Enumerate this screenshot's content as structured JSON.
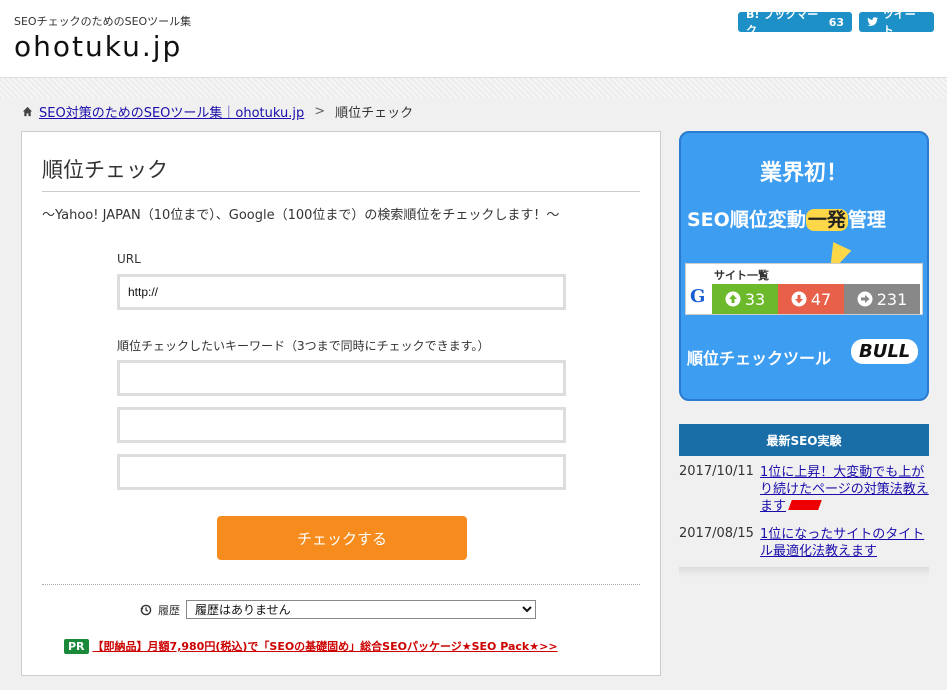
{
  "header": {
    "tagline": "SEOチェックのためのSEOツール集",
    "site_title": "ohotuku.jp",
    "hatena_label": "B! ブックマーク",
    "hatena_count": "63",
    "tweet_label": "ツイート"
  },
  "breadcrumb": {
    "home": "SEO対策のためのSEOツール集｜ohotuku.jp",
    "separator": ">",
    "current": "順位チェック"
  },
  "main": {
    "title": "順位チェック",
    "subtitle": "〜Yahoo! JAPAN（10位まで）、Google（100位まで）の検索順位をチェックします！〜",
    "url_label": "URL",
    "url_value": "http://",
    "keyword_label": "順位チェックしたいキーワード（3つまで同時にチェックできます。）",
    "keywords": [
      "",
      "",
      ""
    ],
    "submit_label": "チェックする",
    "history_label": "履歴",
    "history_selected": "履歴はありません",
    "pr_badge": "PR",
    "pr_text": "【即納品】月額7,980円(税込)で「SEOの基礎固め」総合SEOパッケージ★SEO Pack★>>"
  },
  "banner": {
    "headline": "業界初！",
    "main_text_before": "SEO順位変動",
    "main_text_highlight": "一発",
    "main_text_after": "管理",
    "panel_title": "サイト一覧",
    "g_letter": "G",
    "stat_up": "33",
    "stat_down": "47",
    "stat_flat": "231",
    "bottom_text": "順位チェックツール",
    "brand": "BULL"
  },
  "sidebar": {
    "heading": "最新SEO実験",
    "items": [
      {
        "date": "2017/10/11",
        "title": "1位に上昇！大変動でも上がり続けたページの対策法教えます"
      },
      {
        "date": "2017/08/15",
        "title": "1位になったサイトのタイトル最適化法教えます"
      }
    ]
  },
  "colors": {
    "accent_orange": "#f78c1e",
    "link_blue": "#1a0dab",
    "sidebar_head": "#1a6ea8",
    "banner_blue": "#3d9df0",
    "pr_green": "#1a8a3a",
    "pr_red": "#cc0000"
  },
  "icons": {
    "home": "home-icon",
    "history": "clock-icon",
    "tweet": "twitter-bird-icon",
    "up": "arrow-up-circle-icon",
    "down": "arrow-down-circle-icon",
    "flat": "arrow-right-circle-icon"
  }
}
